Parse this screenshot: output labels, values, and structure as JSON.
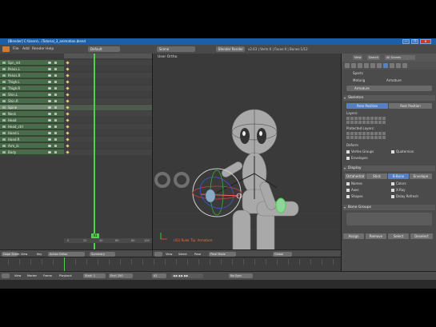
{
  "window": {
    "title": "[Blender] C:\\Users\\...\\Tutorial_3_animation.blend",
    "controls": [
      "—",
      "❐",
      "✕"
    ]
  },
  "menubar": {
    "items": [
      "File",
      "Add",
      "Render",
      "Help"
    ],
    "screen_value": "Default",
    "scene_value": "Scene",
    "engine_value": "Blender Render",
    "stats": "v2.63 | Verts:0 | Faces:0 | Bones:1/12"
  },
  "dopesheet": {
    "channels": [
      "Spn_rot",
      "Pelvis.L",
      "Pelvis.R",
      "Thigh.L",
      "Thigh.R",
      "Shin.L",
      "Shin.R",
      "Spine",
      "Neck",
      "Head",
      "Head_ctrl",
      "Hand.L",
      "Hand.R",
      "Arm_ik",
      "Body"
    ],
    "selected_channel_index": 7,
    "current_frame": "41",
    "ruler_numbers": [
      "0",
      "20",
      "40",
      "60",
      "80",
      "100"
    ],
    "header": {
      "mode_label": "Dope Sheet",
      "view_label": "View",
      "key_label": "Key",
      "action_label": "Action Editor",
      "summary_label": "Summary"
    }
  },
  "viewport": {
    "header_label": "User Ortho",
    "caption": "(41) Ruler Tip: Armature",
    "bar": {
      "view": "View",
      "select": "Select",
      "pose": "Pose",
      "mode": "Pose Mode",
      "pivot": "Global"
    }
  },
  "timeline": {
    "view": "View",
    "marker": "Marker",
    "frame": "Frame",
    "playback": "Playback",
    "start_label": "Start: 1",
    "end_label": "End: 250",
    "current": "41",
    "sync": "No Sync"
  },
  "properties": {
    "header_tabs": [
      "View",
      "Search",
      "All Scenes"
    ],
    "object_name": "Sports",
    "breadcrumb_1": "Metarig",
    "breadcrumb_2": "Armature",
    "datablock": "Armature",
    "skeleton": {
      "title": "Skeleton",
      "pose_position": "Pose Position",
      "rest_position": "Rest Position",
      "layers_label": "Layers:",
      "protected_label": "Protected Layers:"
    },
    "deform": {
      "title": "Deform",
      "vertex_groups": "Vertex Groups",
      "envelopes": "Envelopes",
      "quaternion": "Quaternion"
    },
    "display": {
      "title": "Display",
      "modes": [
        "Octahedral",
        "Stick",
        "B-Bone",
        "Envelope"
      ],
      "selected_mode_index": 2,
      "names": "Names",
      "axes": "Axes",
      "shapes": "Shapes",
      "colors": "Colors",
      "x_ray": "X-Ray",
      "delay_refresh": "Delay Refresh"
    },
    "bone_groups": {
      "title": "Bone Groups",
      "buttons": [
        "Assign",
        "Remove",
        "Select",
        "Deselect"
      ]
    }
  },
  "colors": {
    "accent": "#5680c2",
    "playhead": "#4fd04f",
    "keyframe": "#e8c66a",
    "titlebar": "#1a5fa8"
  }
}
